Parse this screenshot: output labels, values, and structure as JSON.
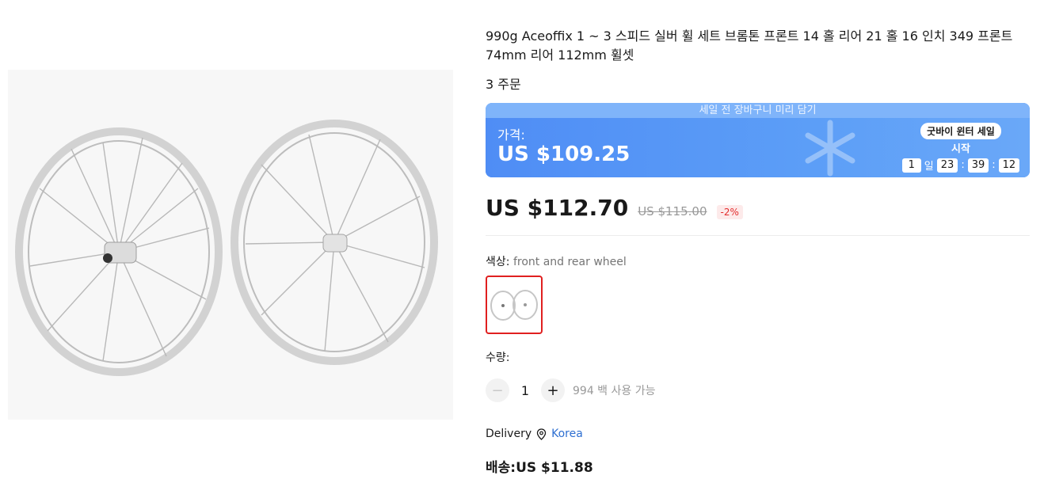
{
  "product": {
    "title": "990g Aceoffix 1 ~ 3 스피드 실버 휠 세트 브롬톤 프론트 14 홀 리어 21 홀 16 인치 349 프론트 74mm 리어 112mm 휠셋",
    "orders": "3 주문"
  },
  "promo": {
    "banner_text": "세일 전 장바구니 미리 담기",
    "price_label": "가격:",
    "price": "US $109.25",
    "event_name": "굿바이 윈터 세일",
    "start_text": "시작",
    "countdown": {
      "days": "1",
      "day_unit": "일",
      "hours": "23",
      "minutes": "39",
      "seconds": "12",
      "sep": ":"
    },
    "accent_color": "#5b9cf7"
  },
  "pricing": {
    "current": "US $112.70",
    "original": "US $115.00",
    "discount": "-2%"
  },
  "color": {
    "label": "색상:",
    "selected": "front and rear wheel"
  },
  "quantity": {
    "label": "수량:",
    "value": "1",
    "available": "994 백 사용 가능",
    "minus_icon": "minus-icon",
    "plus_icon": "plus-icon"
  },
  "delivery": {
    "label": "Delivery",
    "country": "Korea",
    "icon": "location-pin-icon"
  },
  "shipping": {
    "text": "배송:US $11.88"
  }
}
